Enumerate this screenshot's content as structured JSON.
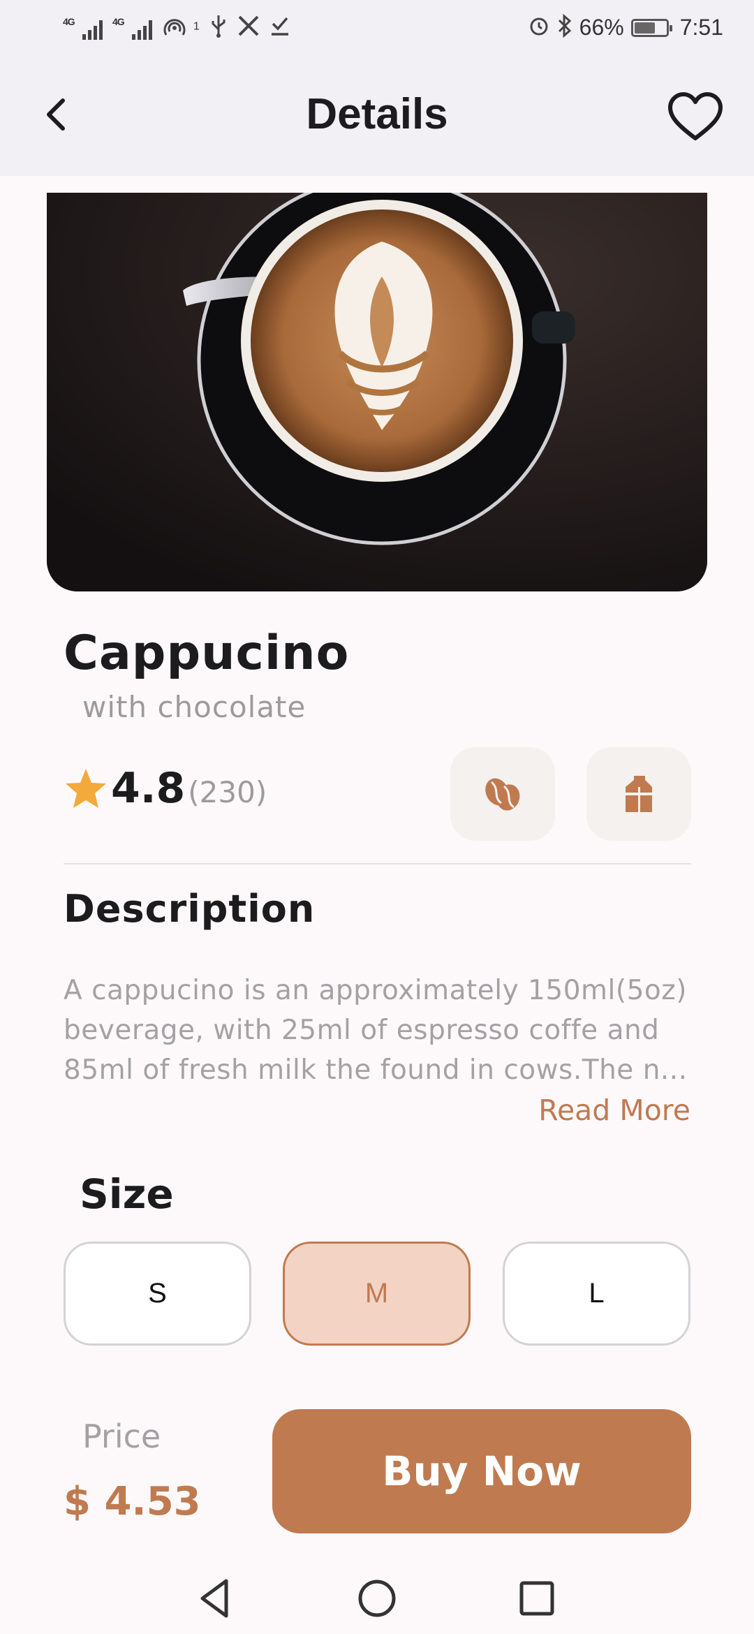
{
  "status_bar": {
    "network_1": "4G",
    "network_2": "4G",
    "hotspot_sup": "1",
    "battery": "66%",
    "time": "7:51"
  },
  "app_bar": {
    "title": "Details",
    "back_icon": "chevron-left-icon",
    "favorite_icon": "heart-outline-icon"
  },
  "product": {
    "image": "cappuccino-latte-art-photo",
    "name": "Cappucino",
    "subtitle": "with chocolate",
    "rating": "4.8",
    "rating_count": "(230)",
    "features": [
      {
        "icon": "coffee-beans-icon"
      },
      {
        "icon": "milk-icon"
      }
    ]
  },
  "description": {
    "title": "Description",
    "lines": [
      "A cappucino is an approximately 150ml(5oz)",
      "beverage, with 25ml of espresso coffe and",
      "85ml of fresh milk the found in cows.The n..."
    ],
    "read_more": "Read More"
  },
  "size": {
    "title": "Size",
    "options": [
      "S",
      "M",
      "L"
    ],
    "selected": "M"
  },
  "purchase": {
    "price_label": "Price",
    "price": "$ 4.53",
    "buy_label": "Buy Now"
  },
  "colors": {
    "accent": "#c07a50",
    "accent_light": "#f2d3c4",
    "star": "#f4a93b",
    "background": "#fdf9fb"
  }
}
